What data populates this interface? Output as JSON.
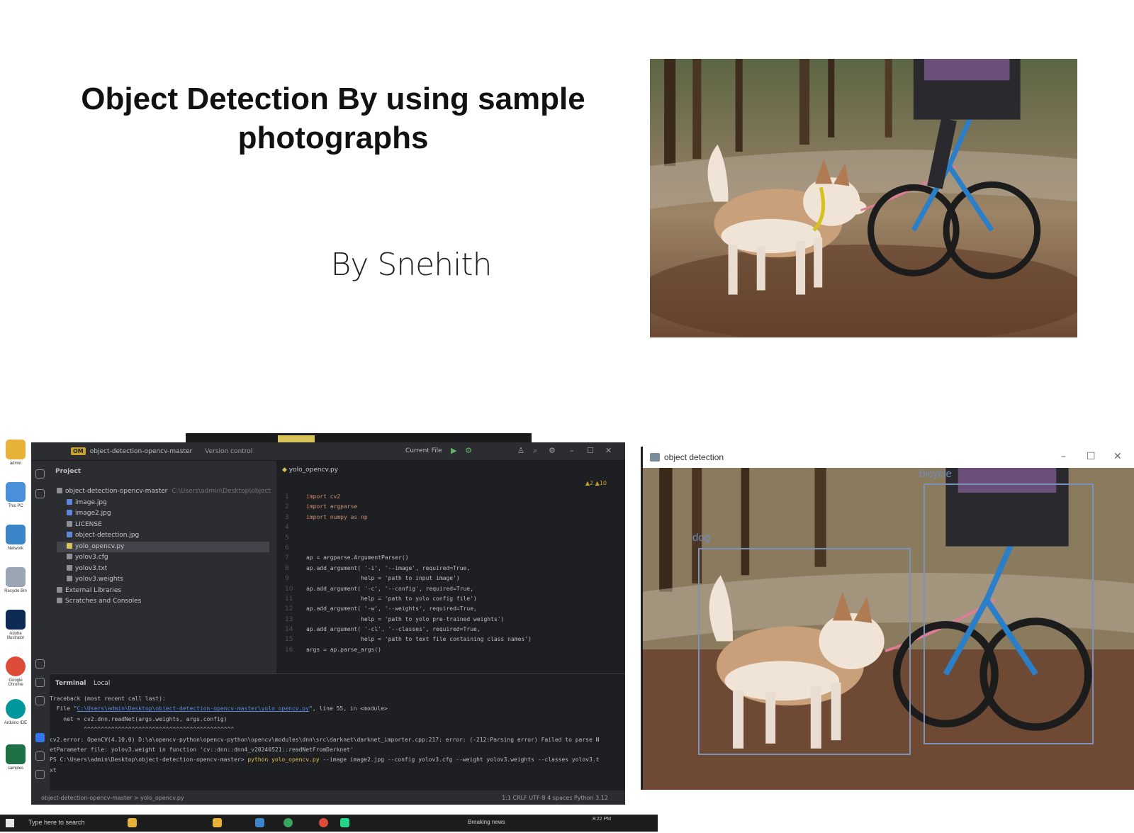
{
  "slide": {
    "title_line1": "Object Detection  By using sample",
    "title_line2": "photographs",
    "author": "By Snehith"
  },
  "detection_window": {
    "title": "object detection",
    "boxes": [
      {
        "label": "dog"
      },
      {
        "label": "bicycle"
      }
    ]
  },
  "ide": {
    "project_badge": "OM",
    "project_name": "object-detection-opencv-master",
    "version_control": "Version control",
    "run_config": "Current File",
    "project_label": "Project",
    "tree": [
      {
        "name": "object-detection-opencv-master",
        "path": "C:\\Users\\admin\\Desktop\\object",
        "icon_color": "#8c8f96",
        "indent": 0
      },
      {
        "name": "image.jpg",
        "icon_color": "#5f86d9",
        "indent": 1
      },
      {
        "name": "image2.jpg",
        "icon_color": "#5f86d9",
        "indent": 1
      },
      {
        "name": "LICENSE",
        "icon_color": "#8c8f96",
        "indent": 1
      },
      {
        "name": "object-detection.jpg",
        "icon_color": "#5f86d9",
        "indent": 1
      },
      {
        "name": "yolo_opencv.py",
        "icon_color": "#d8c25a",
        "indent": 1,
        "selected": true
      },
      {
        "name": "yolov3.cfg",
        "icon_color": "#8c8f96",
        "indent": 1
      },
      {
        "name": "yolov3.txt",
        "icon_color": "#8c8f96",
        "indent": 1
      },
      {
        "name": "yolov3.weights",
        "icon_color": "#8c8f96",
        "indent": 1
      },
      {
        "name": "External Libraries",
        "icon_color": "#8c8f96",
        "indent": 0
      },
      {
        "name": "Scratches and Consoles",
        "icon_color": "#8c8f96",
        "indent": 0
      }
    ],
    "editor_tab": "yolo_opencv.py",
    "warnings": "▲2 ▲10",
    "code": [
      "import cv2",
      "import argparse",
      "import numpy as np",
      "",
      "",
      "",
      "ap = argparse.ArgumentParser()",
      "ap.add_argument( '-i', '--image', required=True,",
      "                help = 'path to input image')",
      "ap.add_argument( '-c', '--config', required=True,",
      "                help = 'path to yolo config file')",
      "ap.add_argument( '-w', '--weights', required=True,",
      "                help = 'path to yolo pre-trained weights')",
      "ap.add_argument( '-cl', '--classes', required=True,",
      "                help = 'path to text file containing class names')",
      "args = ap.parse_args()"
    ],
    "terminal_label": "Terminal",
    "terminal_tab": "Local",
    "terminal": {
      "l1": "Traceback (most recent call last):",
      "l2_pre": "  File \"",
      "l2_link": "C:\\Users\\admin\\Desktop\\object-detection-opencv-master\\yolo_opencv.py",
      "l2_post": "\", line 55, in <module>",
      "l3": "    net = cv2.dnn.readNet(args.weights, args.config)",
      "l4": "          ^^^^^^^^^^^^^^^^^^^^^^^^^^^^^^^^^^^^^^^^^^^^",
      "l5": "cv2.error: OpenCV(4.10.0) D:\\a\\opencv-python\\opencv-python\\opencv\\modules\\dnn\\src\\darknet\\darknet_importer.cpp:217: error: (-212:Parsing error) Failed to parse N",
      "l6": "etParameter file: yolov3.weight in function 'cv::dnn::dnn4_v20240521::readNetFromDarknet'",
      "l7_pre": "PS C:\\Users\\admin\\Desktop\\object-detection-opencv-master> ",
      "l7_cmd": "python yolo_opencv.py",
      "l7_post": " --image image2.jpg --config yolov3.cfg --weight yolov3.weights --classes yolov3.t",
      "l8": "xt"
    },
    "status_left": "object-detection-opencv-master  >  yolo_opencv.py",
    "status_right": "1:1   CRLF   UTF-8   4 spaces   Python 3.12"
  },
  "desktop_icons": [
    {
      "label": "admin",
      "color": "#e8b23a"
    },
    {
      "label": "This PC",
      "color": "#4a90d9"
    },
    {
      "label": "Network",
      "color": "#3a86c9"
    },
    {
      "label": "Recycle Bin",
      "color": "#9aa6b4"
    },
    {
      "label": "Adobe Illustrator",
      "color": "#0e2b56"
    },
    {
      "label": "Google Chrome",
      "color": "#dd4b39"
    },
    {
      "label": "Arduino IDE",
      "color": "#00979d"
    },
    {
      "label": "samples",
      "color": "#1e7145"
    }
  ],
  "taskbar": {
    "search": "Type here to search",
    "news": "Breaking news",
    "time": "8:22 PM"
  }
}
